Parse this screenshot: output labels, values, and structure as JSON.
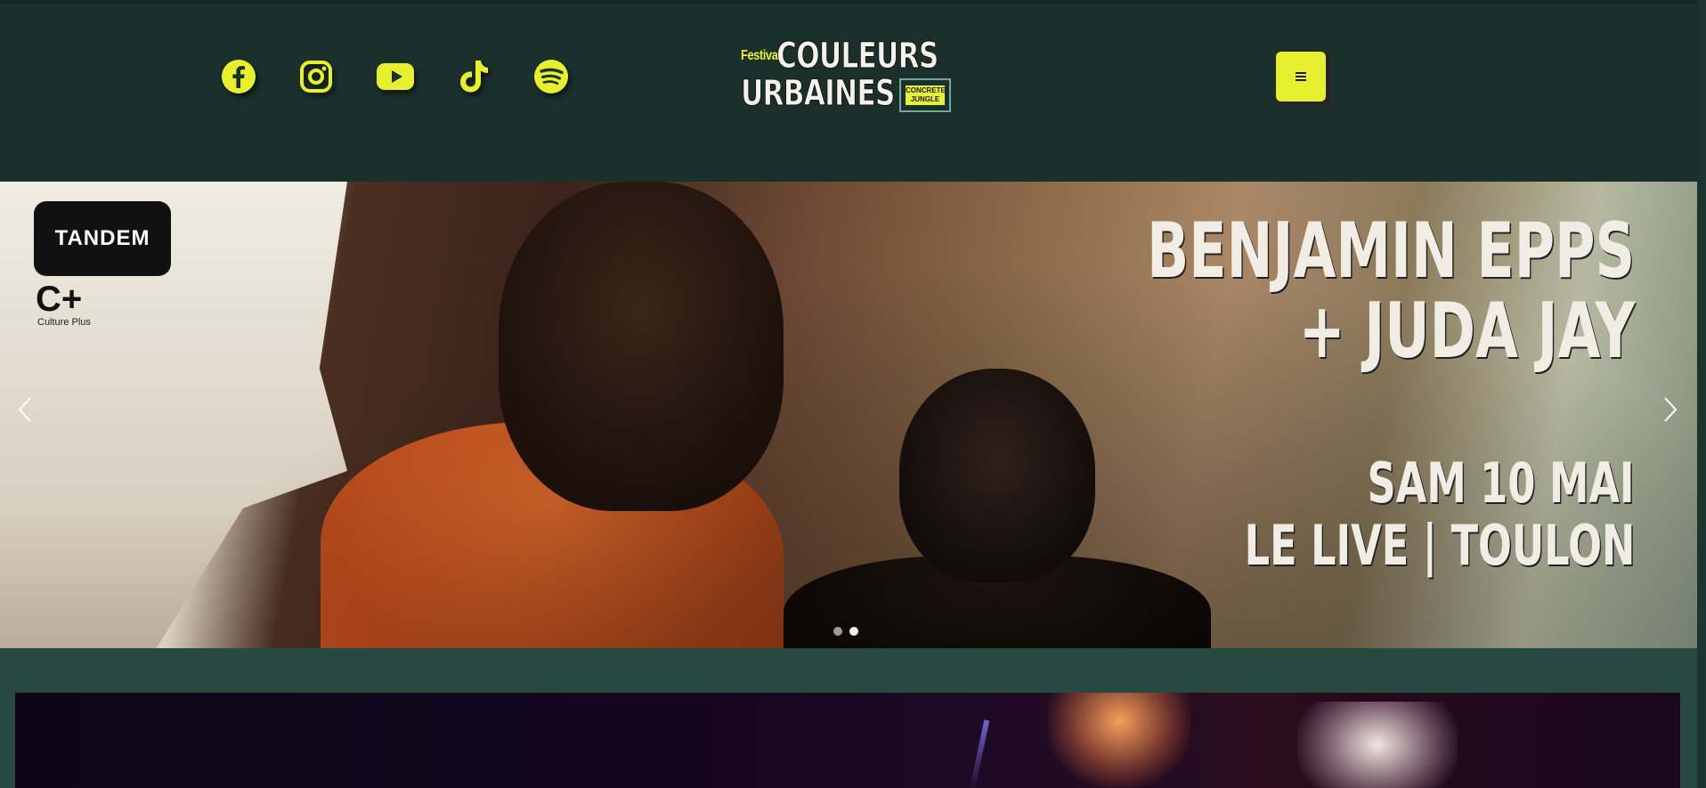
{
  "header": {
    "social_icons": [
      "facebook-icon",
      "instagram-icon",
      "youtube-icon",
      "tiktok-icon",
      "spotify-icon"
    ],
    "logo": {
      "festival": "Festival",
      "line1": "COULEURS",
      "line2": "URBAINES",
      "badge": "CONCRETE JUNGLE"
    },
    "menu_icon": "hamburger-icon"
  },
  "slider": {
    "partner1": "TANDEM",
    "partner2_mark": "C+",
    "partner2_name": "Culture Plus",
    "headline_1": "BENJAMIN EPPS",
    "headline_2": "+ JUDA JAY",
    "headline_3": "SAM 10 MAI",
    "headline_4": "LE LIVE | TOULON",
    "slide_count": 2,
    "active_slide": 2
  },
  "colors": {
    "accent": "#e8ef2e",
    "header_bg": "#1b302b",
    "page_bg": "#28493f"
  }
}
